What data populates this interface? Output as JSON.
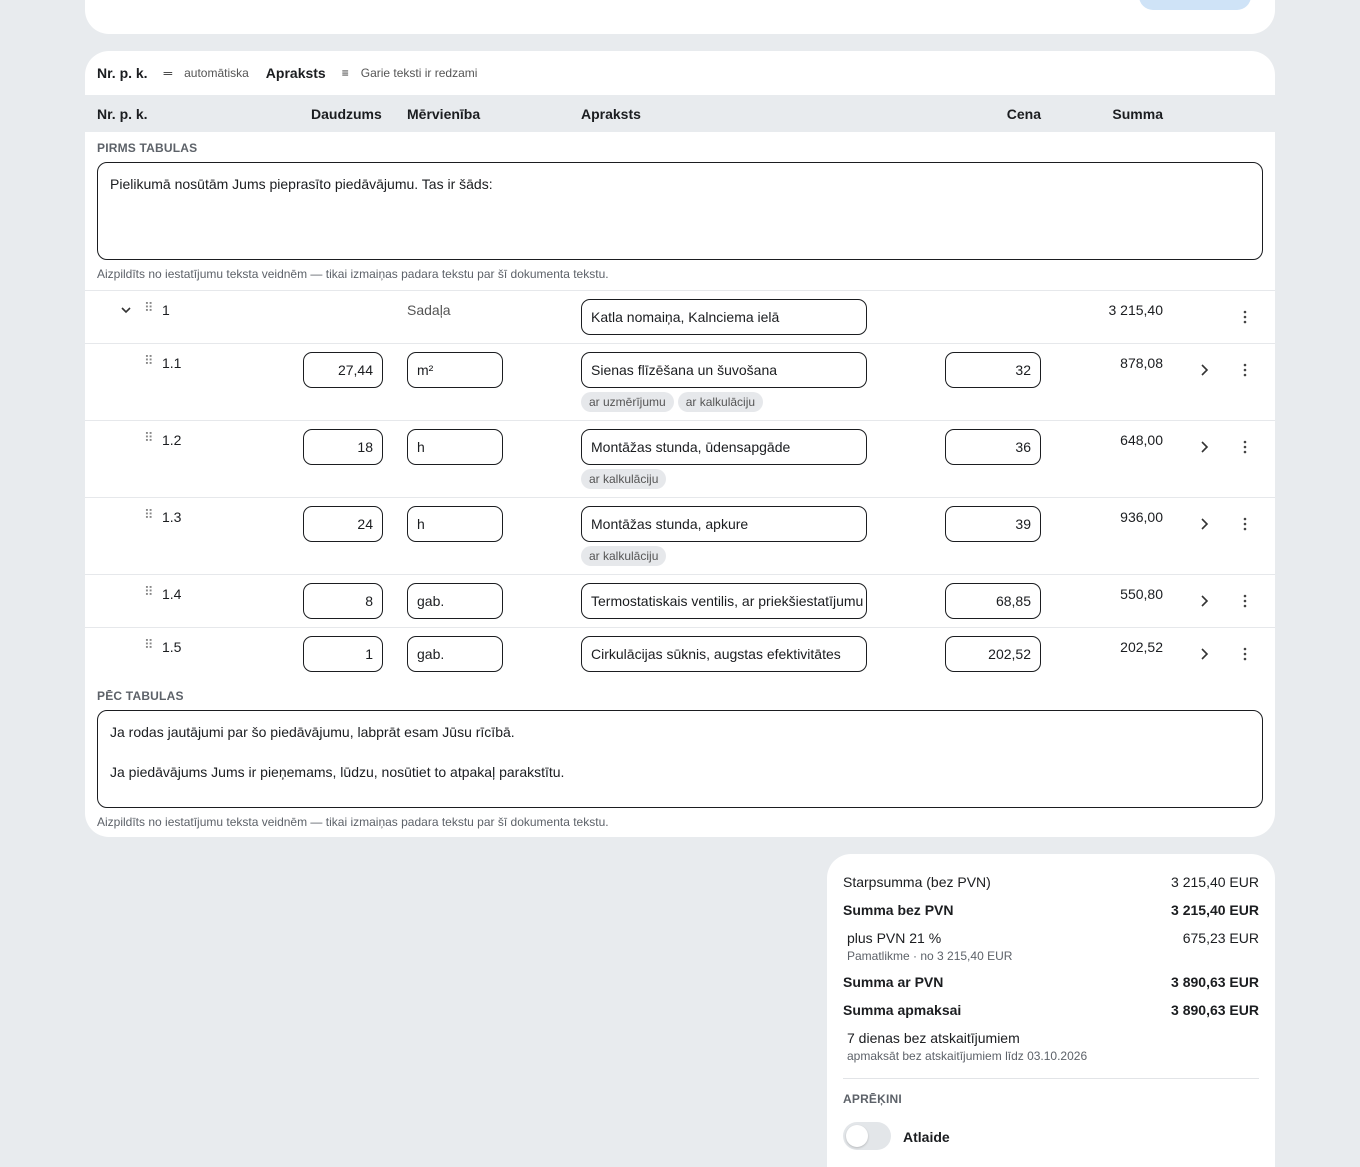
{
  "toolbar": {
    "nr_label": "Nr. p. k.",
    "nr_value": "automātiska",
    "apr_label": "Apraksts",
    "apr_value": "Garie teksti ir redzami"
  },
  "table_header": {
    "nr": "Nr. p. k.",
    "qty": "Daudzums",
    "unit": "Mērvienība",
    "desc": "Apraksts",
    "price": "Cena",
    "sum": "Summa"
  },
  "before_table": {
    "label": "PIRMS TABULAS",
    "text": "Pielikumā nosūtām Jums pieprasīto piedāvājumu. Tas ir šāds:",
    "hint": "Aizpildīts no iestatījumu teksta veidnēm — tikai izmaiņas padara tekstu par šī dokumenta tekstu."
  },
  "section": {
    "nr": "1",
    "type": "Sadaļa",
    "title": "Katla nomaiņa, Kalnciema ielā",
    "sum": "3 215,40"
  },
  "rows": [
    {
      "nr": "1.1",
      "qty": "27,44",
      "unit": "m²",
      "desc": "Sienas flīzēšana un šuvošana",
      "price": "32",
      "sum": "878,08",
      "tags": [
        "ar uzmērījumu",
        "ar kalkulāciju"
      ]
    },
    {
      "nr": "1.2",
      "qty": "18",
      "unit": "h",
      "desc": "Montāžas stunda, ūdensapgāde",
      "price": "36",
      "sum": "648,00",
      "tags": [
        "ar kalkulāciju"
      ]
    },
    {
      "nr": "1.3",
      "qty": "24",
      "unit": "h",
      "desc": "Montāžas stunda, apkure",
      "price": "39",
      "sum": "936,00",
      "tags": [
        "ar kalkulāciju"
      ]
    },
    {
      "nr": "1.4",
      "qty": "8",
      "unit": "gab.",
      "desc": "Termostatiskais ventilis, ar priekšiestatījumu",
      "price": "68,85",
      "sum": "550,80",
      "tags": []
    },
    {
      "nr": "1.5",
      "qty": "1",
      "unit": "gab.",
      "desc": "Cirkulācijas sūknis, augstas efektivitātes",
      "price": "202,52",
      "sum": "202,52",
      "tags": []
    }
  ],
  "after_table": {
    "label": "PĒC TABULAS",
    "text": "Ja rodas jautājumi par šo piedāvājumu, labprāt esam Jūsu rīcībā.\n\nJa piedāvājums Jums ir pieņemams, lūdzu, nosūtiet to atpakaļ parakstītu.",
    "hint": "Aizpildīts no iestatījumu teksta veidnēm — tikai izmaiņas padara tekstu par šī dokumenta tekstu."
  },
  "summary": {
    "subtotal_label": "Starpsumma (bez PVN)",
    "subtotal_value": "3 215,40 EUR",
    "net_label": "Summa bez PVN",
    "net_value": "3 215,40 EUR",
    "vat_label": "plus PVN 21 %",
    "vat_value": "675,23 EUR",
    "vat_sub": "Pamatlikme · no 3 215,40 EUR",
    "gross_label": "Summa ar PVN",
    "gross_value": "3 890,63 EUR",
    "pay_label": "Summa apmaksai",
    "pay_value": "3 890,63 EUR",
    "terms_label": "7 dienas bez atskaitījumiem",
    "terms_sub": "apmaksāt bez atskaitījumiem līdz 03.10.2026",
    "calc_label": "APRĒĶINI",
    "discount_label": "Atlaide",
    "discount_on": false
  }
}
